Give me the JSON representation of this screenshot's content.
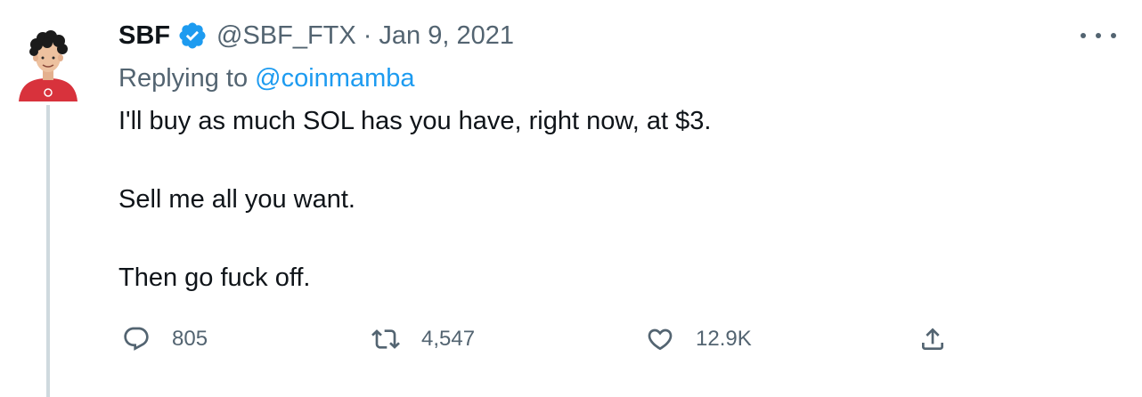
{
  "tweet": {
    "author_name": "SBF",
    "handle": "@SBF_FTX",
    "separator": "·",
    "date": "Jan 9, 2021",
    "replying_prefix": "Replying to ",
    "replying_to": "@coinmamba",
    "paragraphs": [
      "I'll buy as much SOL has you have, right now, at $3.",
      "Sell me all you want.",
      "Then go fuck off."
    ],
    "stats": {
      "replies": "805",
      "retweets": "4,547",
      "likes": "12.9K"
    }
  },
  "icons": {
    "verified": "verified-badge-icon",
    "more": "more-options-icon",
    "reply": "reply-icon",
    "retweet": "retweet-icon",
    "like": "heart-icon",
    "share": "share-icon"
  },
  "colors": {
    "accent": "#1d9bf0",
    "secondary_text": "#536471",
    "thread_line": "#cfd9de",
    "avatar_shirt": "#d8323c"
  }
}
